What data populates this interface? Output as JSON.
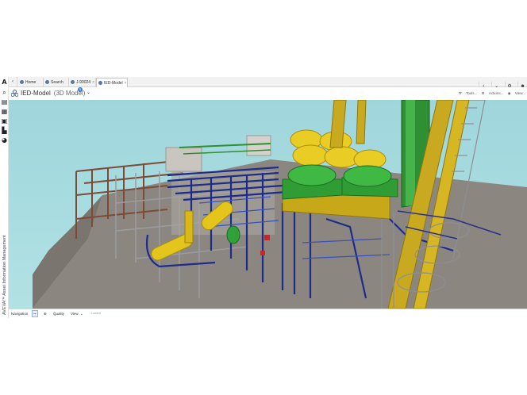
{
  "tabs": [
    {
      "label": "Home",
      "closable": false,
      "active": false,
      "icon": "home-icon"
    },
    {
      "label": "Search",
      "closable": false,
      "active": false,
      "icon": "search-icon"
    },
    {
      "label": "J-90024",
      "closable": true,
      "active": false,
      "icon": "object-icon"
    },
    {
      "label": "IED-Model",
      "closable": true,
      "active": true,
      "icon": "model-icon"
    }
  ],
  "header": {
    "title": "IED-Model",
    "subtitle": "(3D Model)",
    "badge": "5",
    "tools": "Tools...",
    "actions": "Actions...",
    "view": "View..."
  },
  "sidebar": {
    "brand_text": "AVEVA™ Asset Information Management"
  },
  "bottombar": {
    "navigation": "Navigation",
    "quality": "Quality",
    "view": "View",
    "hint": "Loaded"
  },
  "colors": {
    "sky": "#a9dde1",
    "ground": "#8e8a84",
    "accent": "#3a7bd5"
  }
}
